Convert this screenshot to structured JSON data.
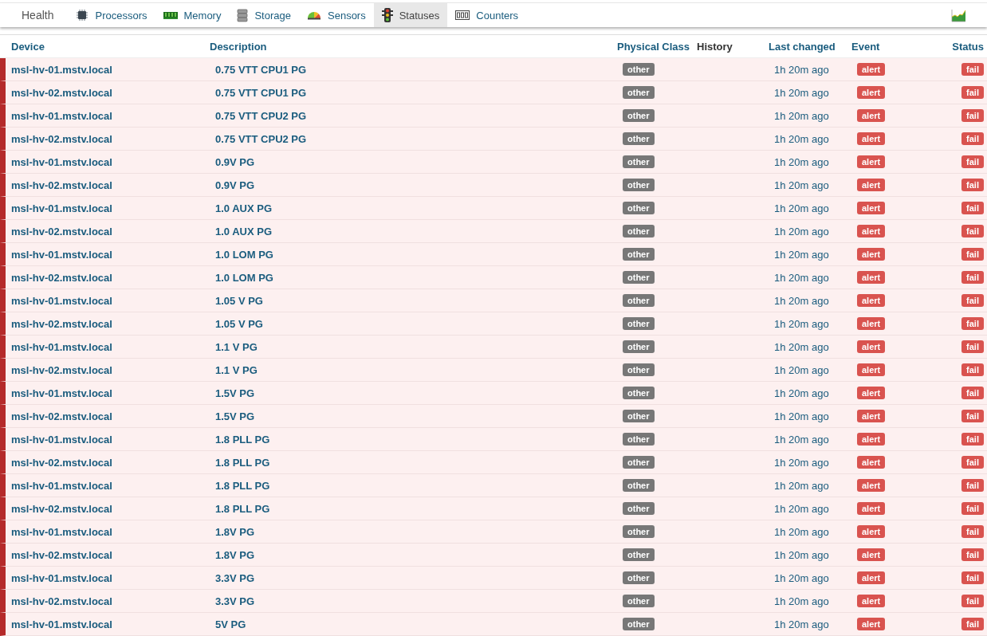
{
  "nav": {
    "title": "Health",
    "tabs": [
      {
        "label": "Processors",
        "selected": false
      },
      {
        "label": "Memory",
        "selected": false
      },
      {
        "label": "Storage",
        "selected": false
      },
      {
        "label": "Sensors",
        "selected": false
      },
      {
        "label": "Statuses",
        "selected": true
      },
      {
        "label": "Counters",
        "selected": false
      }
    ]
  },
  "table": {
    "columns": [
      {
        "label": "Device",
        "sortable": true
      },
      {
        "label": "Description",
        "sortable": true
      },
      {
        "label": "Physical Class",
        "sortable": true
      },
      {
        "label": "History",
        "sortable": false
      },
      {
        "label": "Last changed",
        "sortable": true
      },
      {
        "label": "Event",
        "sortable": true
      },
      {
        "label": "Status",
        "sortable": true
      }
    ],
    "rows": [
      {
        "device": "msl-hv-01.mstv.local",
        "description": "0.75 VTT CPU1 PG",
        "physical_class": "other",
        "last_changed": "1h 20m ago",
        "event": "alert",
        "status": "fail",
        "alert": true
      },
      {
        "device": "msl-hv-02.mstv.local",
        "description": "0.75 VTT CPU1 PG",
        "physical_class": "other",
        "last_changed": "1h 20m ago",
        "event": "alert",
        "status": "fail",
        "alert": true
      },
      {
        "device": "msl-hv-01.mstv.local",
        "description": "0.75 VTT CPU2 PG",
        "physical_class": "other",
        "last_changed": "1h 20m ago",
        "event": "alert",
        "status": "fail",
        "alert": true
      },
      {
        "device": "msl-hv-02.mstv.local",
        "description": "0.75 VTT CPU2 PG",
        "physical_class": "other",
        "last_changed": "1h 20m ago",
        "event": "alert",
        "status": "fail",
        "alert": true
      },
      {
        "device": "msl-hv-01.mstv.local",
        "description": "0.9V PG",
        "physical_class": "other",
        "last_changed": "1h 20m ago",
        "event": "alert",
        "status": "fail",
        "alert": true
      },
      {
        "device": "msl-hv-02.mstv.local",
        "description": "0.9V PG",
        "physical_class": "other",
        "last_changed": "1h 20m ago",
        "event": "alert",
        "status": "fail",
        "alert": true
      },
      {
        "device": "msl-hv-01.mstv.local",
        "description": "1.0 AUX PG",
        "physical_class": "other",
        "last_changed": "1h 20m ago",
        "event": "alert",
        "status": "fail",
        "alert": true
      },
      {
        "device": "msl-hv-02.mstv.local",
        "description": "1.0 AUX PG",
        "physical_class": "other",
        "last_changed": "1h 20m ago",
        "event": "alert",
        "status": "fail",
        "alert": true
      },
      {
        "device": "msl-hv-01.mstv.local",
        "description": "1.0 LOM PG",
        "physical_class": "other",
        "last_changed": "1h 20m ago",
        "event": "alert",
        "status": "fail",
        "alert": true
      },
      {
        "device": "msl-hv-02.mstv.local",
        "description": "1.0 LOM PG",
        "physical_class": "other",
        "last_changed": "1h 20m ago",
        "event": "alert",
        "status": "fail",
        "alert": true
      },
      {
        "device": "msl-hv-01.mstv.local",
        "description": "1.05 V PG",
        "physical_class": "other",
        "last_changed": "1h 20m ago",
        "event": "alert",
        "status": "fail",
        "alert": true
      },
      {
        "device": "msl-hv-02.mstv.local",
        "description": "1.05 V PG",
        "physical_class": "other",
        "last_changed": "1h 20m ago",
        "event": "alert",
        "status": "fail",
        "alert": true
      },
      {
        "device": "msl-hv-01.mstv.local",
        "description": "1.1 V PG",
        "physical_class": "other",
        "last_changed": "1h 20m ago",
        "event": "alert",
        "status": "fail",
        "alert": true
      },
      {
        "device": "msl-hv-02.mstv.local",
        "description": "1.1 V PG",
        "physical_class": "other",
        "last_changed": "1h 20m ago",
        "event": "alert",
        "status": "fail",
        "alert": true
      },
      {
        "device": "msl-hv-01.mstv.local",
        "description": "1.5V PG",
        "physical_class": "other",
        "last_changed": "1h 20m ago",
        "event": "alert",
        "status": "fail",
        "alert": true
      },
      {
        "device": "msl-hv-02.mstv.local",
        "description": "1.5V PG",
        "physical_class": "other",
        "last_changed": "1h 20m ago",
        "event": "alert",
        "status": "fail",
        "alert": true
      },
      {
        "device": "msl-hv-01.mstv.local",
        "description": "1.8 PLL PG",
        "physical_class": "other",
        "last_changed": "1h 20m ago",
        "event": "alert",
        "status": "fail",
        "alert": true
      },
      {
        "device": "msl-hv-02.mstv.local",
        "description": "1.8 PLL PG",
        "physical_class": "other",
        "last_changed": "1h 20m ago",
        "event": "alert",
        "status": "fail",
        "alert": true
      },
      {
        "device": "msl-hv-01.mstv.local",
        "description": "1.8 PLL PG",
        "physical_class": "other",
        "last_changed": "1h 20m ago",
        "event": "alert",
        "status": "fail",
        "alert": true
      },
      {
        "device": "msl-hv-02.mstv.local",
        "description": "1.8 PLL PG",
        "physical_class": "other",
        "last_changed": "1h 20m ago",
        "event": "alert",
        "status": "fail",
        "alert": true
      },
      {
        "device": "msl-hv-01.mstv.local",
        "description": "1.8V PG",
        "physical_class": "other",
        "last_changed": "1h 20m ago",
        "event": "alert",
        "status": "fail",
        "alert": true
      },
      {
        "device": "msl-hv-02.mstv.local",
        "description": "1.8V PG",
        "physical_class": "other",
        "last_changed": "1h 20m ago",
        "event": "alert",
        "status": "fail",
        "alert": true
      },
      {
        "device": "msl-hv-01.mstv.local",
        "description": "3.3V PG",
        "physical_class": "other",
        "last_changed": "1h 20m ago",
        "event": "alert",
        "status": "fail",
        "alert": true
      },
      {
        "device": "msl-hv-02.mstv.local",
        "description": "3.3V PG",
        "physical_class": "other",
        "last_changed": "1h 20m ago",
        "event": "alert",
        "status": "fail",
        "alert": true
      },
      {
        "device": "msl-hv-01.mstv.local",
        "description": "5V PG",
        "physical_class": "other",
        "last_changed": "1h 20m ago",
        "event": "alert",
        "status": "fail",
        "alert": true
      }
    ]
  }
}
